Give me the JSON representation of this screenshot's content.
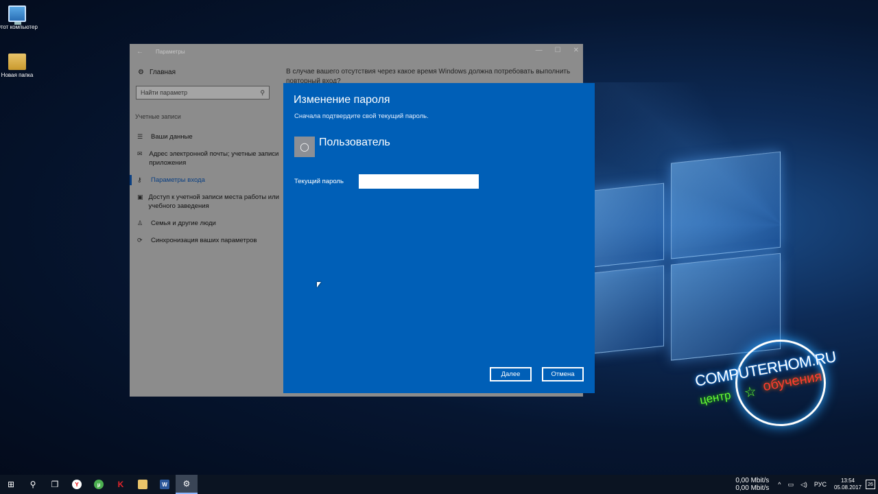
{
  "desktop": {
    "icons": [
      {
        "label": "Этот компьютер",
        "icon": "this-pc-icon"
      },
      {
        "label": "Новая папка",
        "icon": "folder-icon"
      }
    ]
  },
  "settings_window": {
    "title": "Параметры",
    "home_label": "Главная",
    "search_placeholder": "Найти параметр",
    "section_title": "Учетные записи",
    "nav": [
      {
        "label": "Ваши данные",
        "icon": "person-card-icon",
        "active": false
      },
      {
        "label": "Адрес электронной почты; учетные записи приложения",
        "icon": "mail-icon",
        "active": false
      },
      {
        "label": "Параметры входа",
        "icon": "key-icon",
        "active": true
      },
      {
        "label": "Доступ к учетной записи места работы или учебного заведения",
        "icon": "briefcase-icon",
        "active": false
      },
      {
        "label": "Семья и другие люди",
        "icon": "person-icon",
        "active": false
      },
      {
        "label": "Синхронизация ваших параметров",
        "icon": "sync-icon",
        "active": false
      }
    ],
    "content_text": "В случае вашего отсутствия через какое время Windows должна потребовать выполнить повторный вход?"
  },
  "dialog": {
    "title": "Изменение пароля",
    "subtitle": "Сначала подтвердите свой текущий пароль.",
    "user_name": "Пользователь",
    "field_label": "Текущий пароль",
    "field_value": "",
    "next_label": "Далее",
    "cancel_label": "Отмена",
    "accent_color": "#005fb7"
  },
  "watermark": {
    "site": "COMPUTERHOM.RU",
    "sub1": "центр",
    "sub2": "обучения"
  },
  "taskbar": {
    "net_up": "0,00 Mbit/s",
    "net_down": "0,00 Mbit/s",
    "lang": "РУС",
    "time": "13:54",
    "date": "05.08.2017",
    "notifications": "26",
    "apps": [
      "start-icon",
      "search-icon",
      "task-view-icon",
      "yandex-browser-icon",
      "utorrent-icon",
      "kaspersky-icon",
      "file-explorer-icon",
      "word-icon",
      "settings-gear-icon"
    ]
  }
}
